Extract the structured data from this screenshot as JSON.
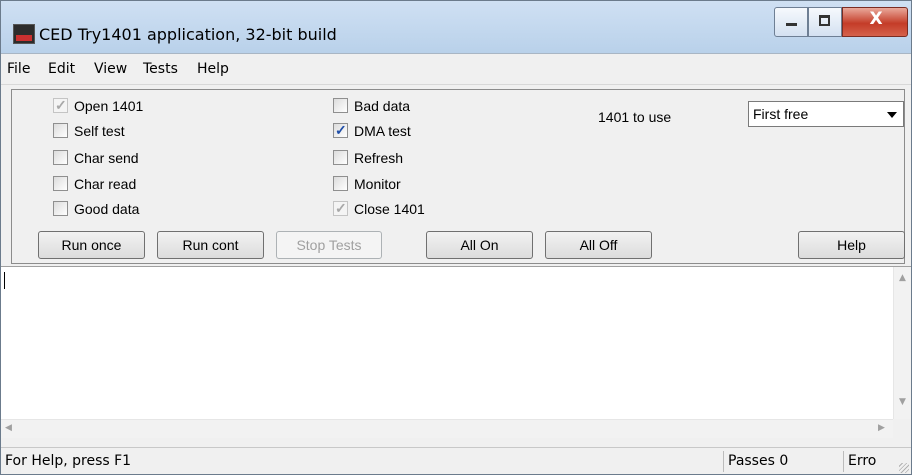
{
  "window": {
    "title": "CED Try1401 application, 32-bit build",
    "close_symbol": "X"
  },
  "menu": {
    "items": [
      {
        "label": "File"
      },
      {
        "label": "Edit"
      },
      {
        "label": "View"
      },
      {
        "label": "Tests"
      },
      {
        "label": "Help"
      }
    ]
  },
  "options": {
    "left": [
      {
        "label": "Open 1401",
        "checked": true,
        "enabled": false
      },
      {
        "label": "Self test",
        "checked": false,
        "enabled": true
      },
      {
        "label": "Char send",
        "checked": false,
        "enabled": true
      },
      {
        "label": "Char read",
        "checked": false,
        "enabled": true
      },
      {
        "label": "Good data",
        "checked": false,
        "enabled": true
      }
    ],
    "middle": [
      {
        "label": "Bad data",
        "checked": false,
        "enabled": true
      },
      {
        "label": "DMA test",
        "checked": true,
        "enabled": true
      },
      {
        "label": "Refresh",
        "checked": false,
        "enabled": true
      },
      {
        "label": "Monitor",
        "checked": false,
        "enabled": true
      },
      {
        "label": "Close 1401",
        "checked": true,
        "enabled": false
      }
    ]
  },
  "device": {
    "label": "1401 to use",
    "selected": "First free"
  },
  "buttons": {
    "run_once": "Run once",
    "run_cont": "Run cont",
    "stop_tests": "Stop Tests",
    "all_on": "All On",
    "all_off": "All Off",
    "help": "Help"
  },
  "status": {
    "help_text": "For Help, press F1",
    "passes": "Passes 0",
    "errors": "Erro"
  }
}
